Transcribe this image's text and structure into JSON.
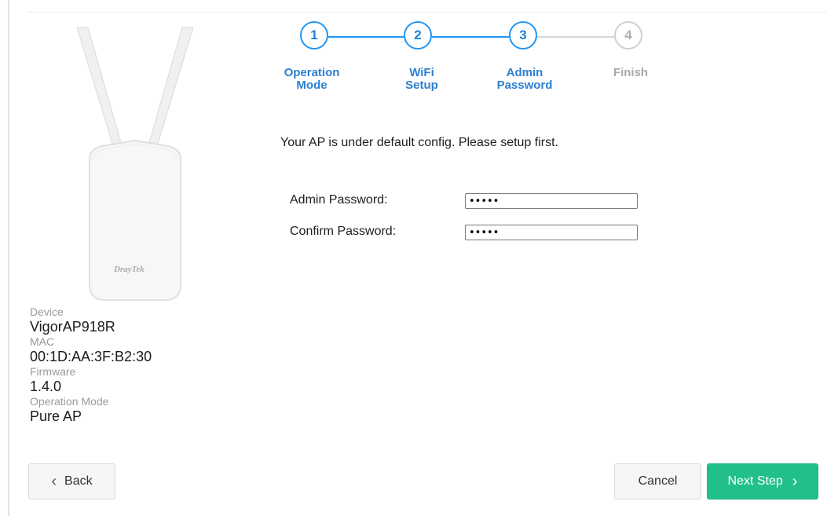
{
  "stepper": {
    "steps": [
      {
        "number": "1",
        "label_line1": "Operation",
        "label_line2": "Mode",
        "state": "active"
      },
      {
        "number": "2",
        "label_line1": "WiFi",
        "label_line2": "Setup",
        "state": "active"
      },
      {
        "number": "3",
        "label_line1": "Admin",
        "label_line2": "Password",
        "state": "active"
      },
      {
        "number": "4",
        "label_line1": "Finish",
        "label_line2": "",
        "state": "inactive"
      }
    ]
  },
  "intro_text": "Your AP is under default config. Please setup first.",
  "form": {
    "admin_password_label": "Admin Password:",
    "admin_password_value": "admin",
    "confirm_password_label": "Confirm Password:",
    "confirm_password_value": "admin"
  },
  "device_info": {
    "device_label": "Device",
    "device_value": "VigorAP918R",
    "mac_label": "MAC",
    "mac_value": "00:1D:AA:3F:B2:30",
    "firmware_label": "Firmware",
    "firmware_value": "1.4.0",
    "mode_label": "Operation Mode",
    "mode_value": "Pure AP"
  },
  "device_brand": "DrayTek",
  "buttons": {
    "back": "Back",
    "cancel": "Cancel",
    "next": "Next Step"
  },
  "colors": {
    "accent": "#2196f3",
    "primary_button": "#21c08b",
    "inactive": "#cfcfcf"
  },
  "icons": {
    "back": "chevron-left-icon",
    "next": "chevron-right-icon"
  }
}
